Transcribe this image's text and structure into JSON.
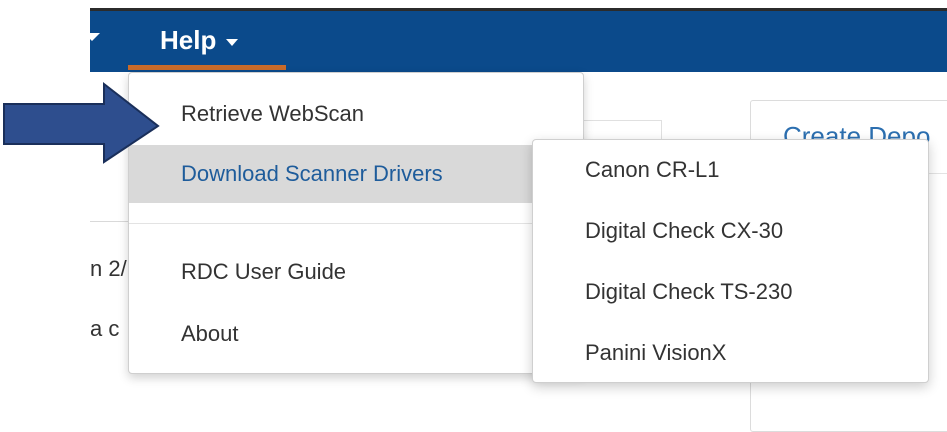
{
  "nav": {
    "help_label": "Help"
  },
  "background": {
    "text_line_1": "n 2/",
    "text_line_2": "a c",
    "panel_title": "Create Depo"
  },
  "help_menu": {
    "items": [
      {
        "label": "Retrieve WebScan"
      },
      {
        "label": "Download Scanner Drivers"
      },
      {
        "label": "RDC User Guide"
      },
      {
        "label": "About"
      }
    ]
  },
  "scanner_submenu": {
    "items": [
      {
        "label": "Canon CR-L1"
      },
      {
        "label": "Digital Check CX-30"
      },
      {
        "label": "Digital Check TS-230"
      },
      {
        "label": "Panini VisionX"
      }
    ]
  },
  "colors": {
    "navbar": "#0b4a8b",
    "active_underline": "#c96b2a",
    "highlight_row": "#d9d9d9",
    "link_blue": "#1e5c9b",
    "arrow_fill": "#2e4e8e",
    "arrow_stroke": "#1a2f5a"
  }
}
